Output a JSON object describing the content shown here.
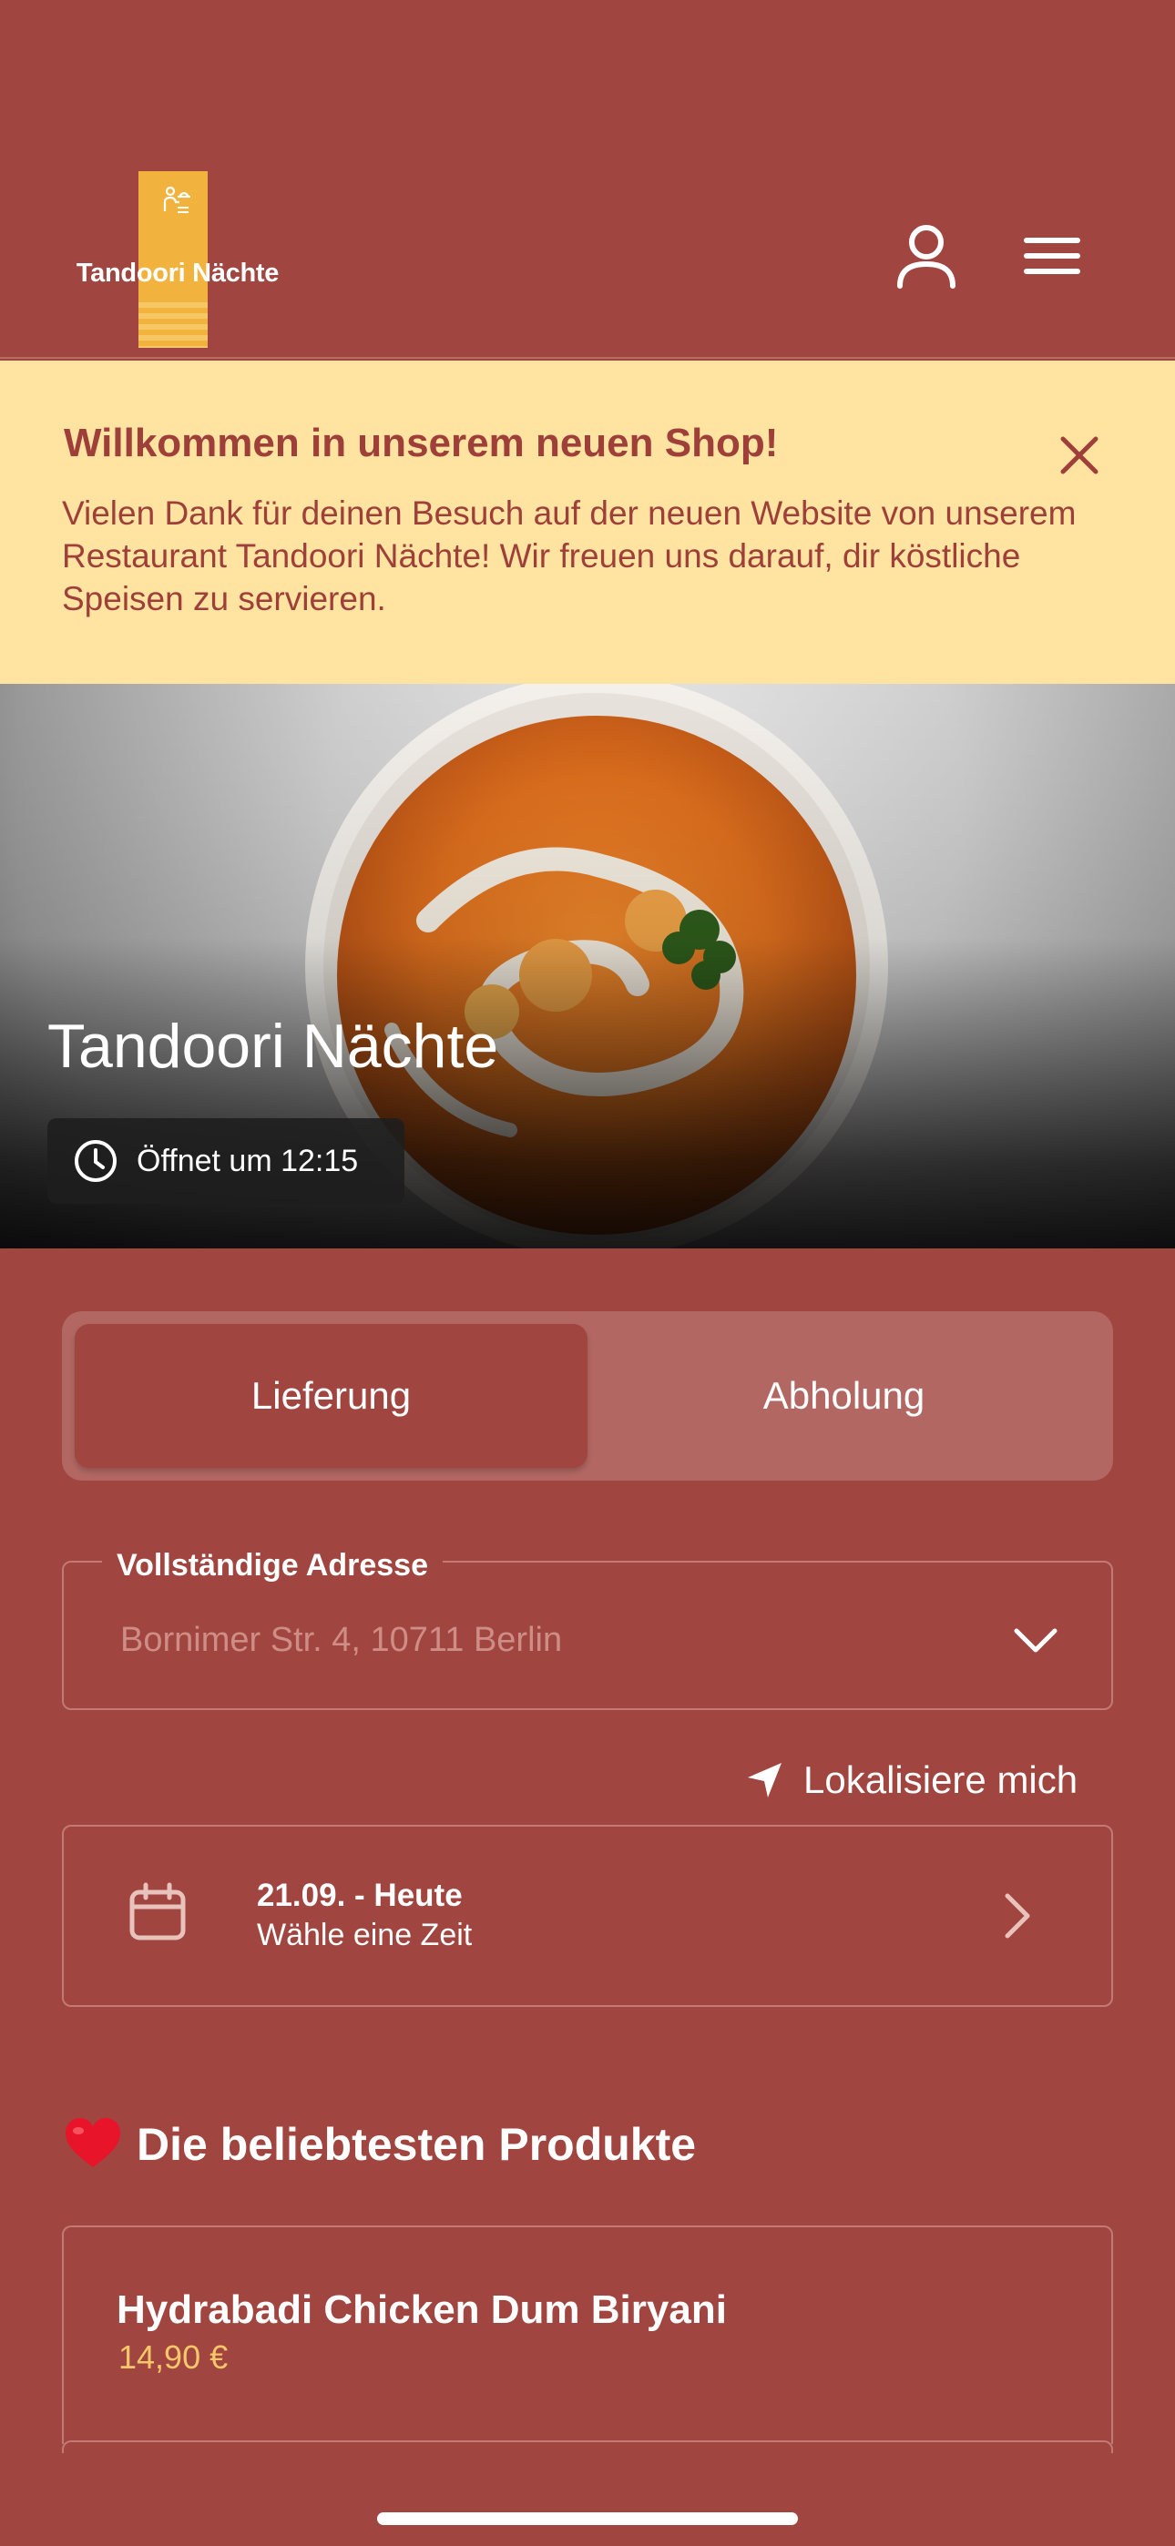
{
  "brand": {
    "logo_text": "Tandoori Nächte",
    "colors": {
      "background": "#A0453F",
      "banner": "#FFE3A1",
      "accent": "#F2B23E",
      "price": "#F6C76A"
    }
  },
  "header": {
    "icons": [
      "user-icon",
      "menu-icon"
    ]
  },
  "banner": {
    "title": "Willkommen in unserem neuen Shop!",
    "text": "Vielen Dank für deinen Besuch auf der neuen Website von unserem Restaurant Tandoori Nächte! Wir freuen uns darauf, dir köstliche Speisen zu servieren.",
    "close_icon": "close-icon"
  },
  "hero": {
    "title": "Tandoori Nächte",
    "opening_status": "Öffnet um 12:15",
    "status_icon": "clock-icon"
  },
  "order_mode": {
    "tabs": [
      {
        "label": "Lieferung",
        "active": true
      },
      {
        "label": "Abholung",
        "active": false
      }
    ]
  },
  "address": {
    "label": "Vollständige Adresse",
    "placeholder": "Bornimer Str. 4, 10711 Berlin",
    "dropdown_icon": "chevron-down-icon"
  },
  "locate": {
    "label": "Lokalisiere mich",
    "icon": "location-arrow-icon"
  },
  "schedule": {
    "title": "21.09. - Heute",
    "subtitle": "Wähle eine Zeit",
    "icon": "calendar-icon"
  },
  "popular": {
    "heading": "Die beliebtesten Produkte",
    "heading_icon": "heart-icon",
    "products": [
      {
        "name": "Hydrabadi Chicken Dum Biryani",
        "price": "14,90 €"
      }
    ]
  }
}
